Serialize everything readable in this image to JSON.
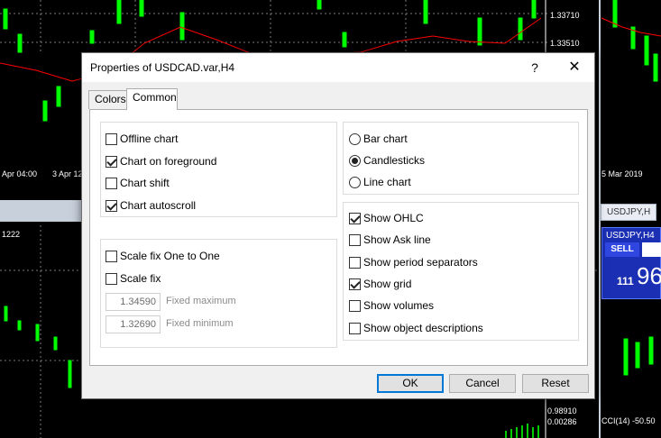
{
  "background": {
    "price_labels": [
      "1.33710",
      "1.33510",
      "0.98910",
      "0.00286"
    ],
    "time_labels": [
      "Apr 04:00",
      "3 Apr 12",
      "5 Mar 2019"
    ],
    "other_label": "1222",
    "usdjpy_tab": "USDJPY,H",
    "one_click": {
      "symbol": "USDJPY,H4",
      "sell_label": "SELL",
      "price_small": "111",
      "price_big": "96"
    },
    "cci_label": "CCI(14) -50.50",
    "cci_box": "-50.5"
  },
  "dialog": {
    "title": "Properties of USDCAD.var,H4",
    "help_glyph": "?",
    "close_glyph": "✕",
    "tabs": [
      {
        "label": "Colors",
        "active": false
      },
      {
        "label": "Common",
        "active": true
      }
    ],
    "chart_options": [
      {
        "label": "Offline chart",
        "checked": false
      },
      {
        "label": "Chart on foreground",
        "checked": true
      },
      {
        "label": "Chart shift",
        "checked": false
      },
      {
        "label": "Chart autoscroll",
        "checked": true
      }
    ],
    "scale": {
      "fix_one_to_one": {
        "label": "Scale fix One to One",
        "checked": false
      },
      "fix": {
        "label": "Scale fix",
        "checked": false
      },
      "fixed_maximum": {
        "value": "1.34590",
        "label": "Fixed maximum"
      },
      "fixed_minimum": {
        "value": "1.32690",
        "label": "Fixed minimum"
      }
    },
    "chart_types": [
      {
        "label": "Bar chart",
        "selected": false
      },
      {
        "label": "Candlesticks",
        "selected": true
      },
      {
        "label": "Line chart",
        "selected": false
      }
    ],
    "show_options": [
      {
        "label": "Show OHLC",
        "checked": true
      },
      {
        "label": "Show Ask line",
        "checked": false
      },
      {
        "label": "Show period separators",
        "checked": false
      },
      {
        "label": "Show grid",
        "checked": true
      },
      {
        "label": "Show volumes",
        "checked": false
      },
      {
        "label": "Show object descriptions",
        "checked": false
      }
    ],
    "buttons": {
      "ok": "OK",
      "cancel": "Cancel",
      "reset": "Reset"
    }
  },
  "colors": {
    "bull_candle": "#00ff00",
    "ma_line": "#ff0000",
    "one_click_bg": "#1b2fb4",
    "ok_border": "#0078d7"
  }
}
